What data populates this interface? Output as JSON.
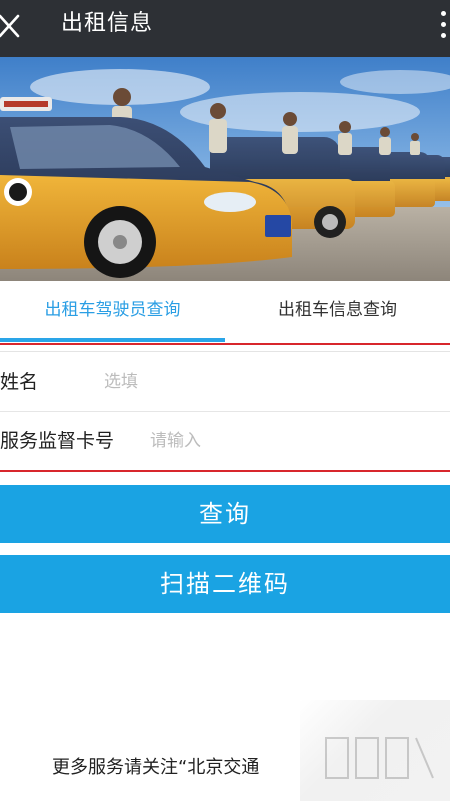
{
  "header": {
    "title": "出租信息",
    "close_icon": "close-icon",
    "more_icon": "more-vertical-icon"
  },
  "banner": {
    "image": "taxi-fleet-photo"
  },
  "tabs": [
    {
      "label": "出租车驾驶员查询",
      "active": true
    },
    {
      "label": "出租车信息查询",
      "active": false
    }
  ],
  "form": {
    "name_label": "姓名",
    "name_placeholder": "选填",
    "card_label": "服务监督卡号",
    "card_placeholder": "请输入"
  },
  "buttons": {
    "query_label": "查询",
    "scan_label": "扫描二维码"
  },
  "footer": {
    "text": "更多服务请关注“北京交通"
  },
  "colors": {
    "header_bg": "#2d3035",
    "accent": "#1aa3e3",
    "active_tab": "#2a9ee4",
    "highlight_red": "#d8262c"
  }
}
